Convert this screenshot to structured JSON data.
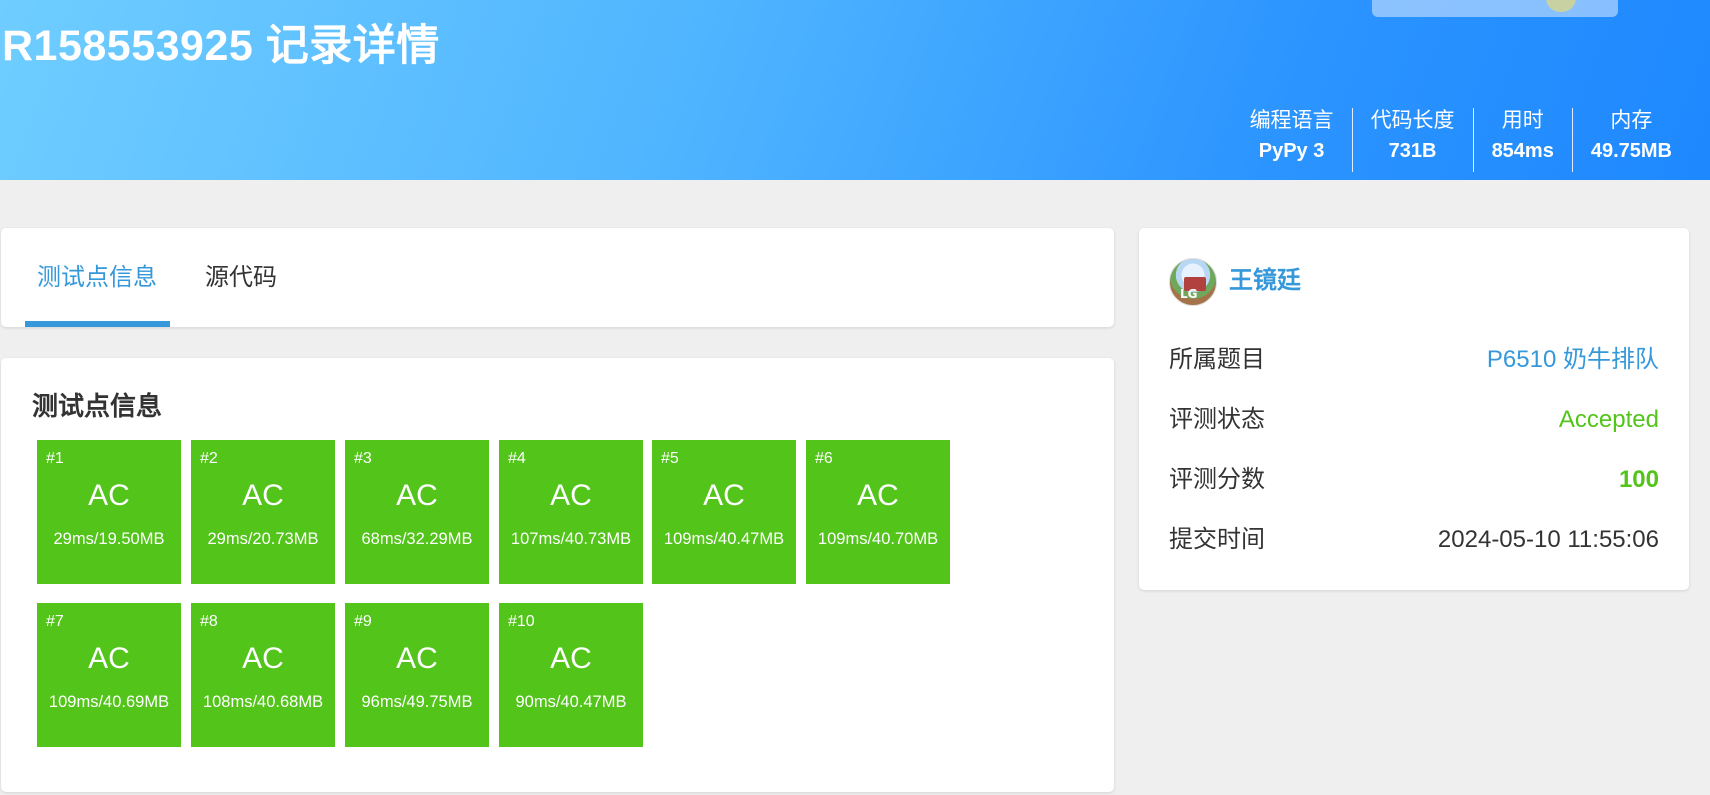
{
  "header": {
    "title": "R158553925 记录详情",
    "stats": [
      {
        "label": "编程语言",
        "value": "PyPy 3"
      },
      {
        "label": "代码长度",
        "value": "731B"
      },
      {
        "label": "用时",
        "value": "854ms"
      },
      {
        "label": "内存",
        "value": "49.75MB"
      }
    ]
  },
  "tabs": [
    {
      "label": "测试点信息",
      "active": true
    },
    {
      "label": "源代码",
      "active": false
    }
  ],
  "tests": {
    "title": "测试点信息",
    "cases": [
      {
        "num": "#1",
        "result": "AC",
        "info": "29ms/19.50MB"
      },
      {
        "num": "#2",
        "result": "AC",
        "info": "29ms/20.73MB"
      },
      {
        "num": "#3",
        "result": "AC",
        "info": "68ms/32.29MB"
      },
      {
        "num": "#4",
        "result": "AC",
        "info": "107ms/40.73MB"
      },
      {
        "num": "#5",
        "result": "AC",
        "info": "109ms/40.47MB"
      },
      {
        "num": "#6",
        "result": "AC",
        "info": "109ms/40.70MB"
      },
      {
        "num": "#7",
        "result": "AC",
        "info": "109ms/40.69MB"
      },
      {
        "num": "#8",
        "result": "AC",
        "info": "108ms/40.68MB"
      },
      {
        "num": "#9",
        "result": "AC",
        "info": "96ms/49.75MB"
      },
      {
        "num": "#10",
        "result": "AC",
        "info": "90ms/40.47MB"
      }
    ]
  },
  "side": {
    "username": "王镜廷",
    "rows": [
      {
        "key": "所属题目",
        "value": "P6510 奶牛排队"
      },
      {
        "key": "评测状态",
        "value": "Accepted"
      },
      {
        "key": "评测分数",
        "value": "100"
      },
      {
        "key": "提交时间",
        "value": "2024-05-10 11:55:06"
      }
    ]
  },
  "colors": {
    "accent": "#3498db",
    "ac_green": "#52c41a",
    "header_start": "#6fcdff",
    "header_end": "#1e88ff"
  }
}
